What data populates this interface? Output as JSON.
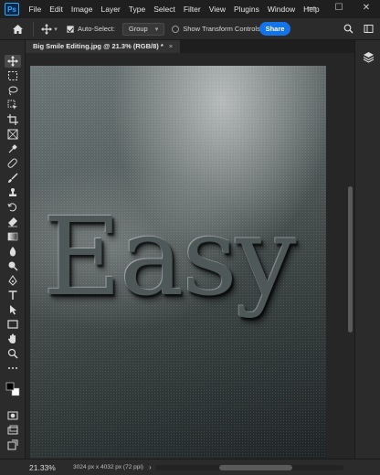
{
  "app": {
    "logo_text": "Ps"
  },
  "menu": [
    "File",
    "Edit",
    "Image",
    "Layer",
    "Type",
    "Select",
    "Filter",
    "View",
    "Plugins",
    "Window",
    "Help"
  ],
  "window_controls": {
    "minimize": "—",
    "maximize": "☐",
    "close": "✕"
  },
  "options": {
    "auto_select_label": "Auto-Select:",
    "auto_select_checked": true,
    "group_value": "Group",
    "show_transform_label": "Show Transform Controls",
    "show_transform_checked": false,
    "share_label": "Share"
  },
  "document": {
    "tab_title": "Big Smile Editing.jpg @ 21.3% (RGB/8) *",
    "canvas_text": "Easy"
  },
  "status": {
    "zoom": "21.33%",
    "doc_info": "3024 px x 4032 px (72 ppi)",
    "arrow": "›"
  },
  "colors": {
    "accent": "#1473e6",
    "canvas_bg": "#262626",
    "panel_bg": "#2b2b2b"
  }
}
